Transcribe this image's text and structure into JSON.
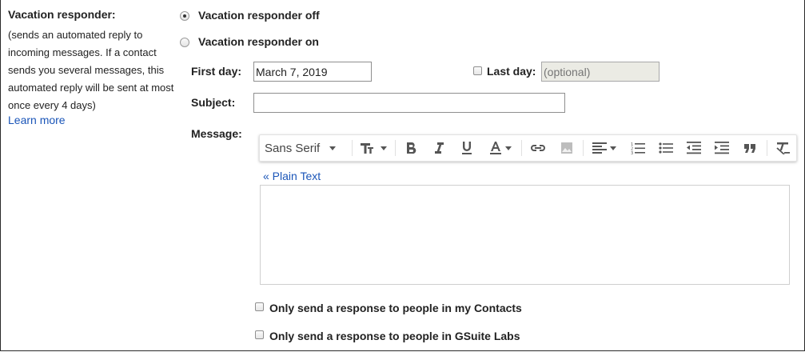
{
  "section": {
    "title": "Vacation responder:",
    "description": "(sends an automated reply to incoming messages. If a contact sends you several messages, this automated reply will be sent at most once every 4 days)",
    "learn_more": "Learn more"
  },
  "options": {
    "off_label": "Vacation responder off",
    "on_label": "Vacation responder on",
    "selected": "off"
  },
  "form": {
    "first_day_label": "First day:",
    "first_day_value": "March 7, 2019",
    "last_day_label": "Last day:",
    "last_day_placeholder": "(optional)",
    "subject_label": "Subject:",
    "subject_value": "",
    "message_label": "Message:"
  },
  "toolbar": {
    "font_family": "Sans Serif",
    "icons": [
      "font-size-icon",
      "bold-icon",
      "italic-icon",
      "underline-icon",
      "text-color-icon",
      "link-icon",
      "image-icon",
      "align-icon",
      "numbered-list-icon",
      "bulleted-list-icon",
      "indent-less-icon",
      "indent-more-icon",
      "quote-icon",
      "remove-formatting-icon"
    ]
  },
  "message": {
    "plain_text_link": "« Plain Text",
    "body": ""
  },
  "checkboxes": {
    "contacts_label": "Only send a response to people in my Contacts",
    "gsuite_label": "Only send a response to people in GSuite Labs"
  }
}
